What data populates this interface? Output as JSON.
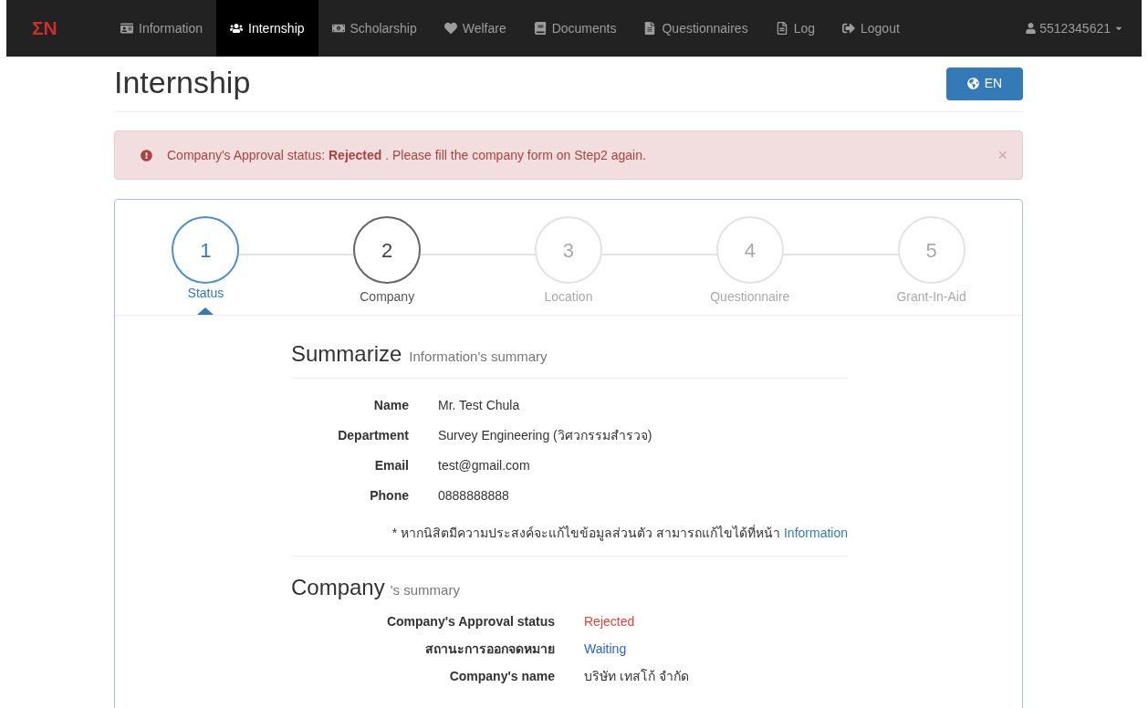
{
  "navbar": {
    "brand": "ΣN",
    "items": [
      {
        "label": "Information",
        "selected": false
      },
      {
        "label": "Internship",
        "selected": true
      },
      {
        "label": "Scholarship",
        "selected": false
      },
      {
        "label": "Welfare",
        "selected": false
      },
      {
        "label": "Documents",
        "selected": false
      },
      {
        "label": "Questionnaires",
        "selected": false
      },
      {
        "label": "Log",
        "selected": false
      },
      {
        "label": "Logout",
        "selected": false
      }
    ],
    "user": "5512345621"
  },
  "page": {
    "title": "Internship",
    "language_button": "EN"
  },
  "alert": {
    "message": "Company's Approval status: **Rejected** . Please fill the company form on Step2 again.",
    "close": "×"
  },
  "steps": [
    {
      "number": "1",
      "label": "Status",
      "kind": "active",
      "selected": true
    },
    {
      "number": "2",
      "label": "Company",
      "kind": "visited",
      "selected": false
    },
    {
      "number": "3",
      "label": "Location",
      "kind": "disabled",
      "selected": false
    },
    {
      "number": "4",
      "label": "Questionnaire",
      "kind": "disabled",
      "selected": false
    },
    {
      "number": "5",
      "label": "Grant-In-Aid",
      "kind": "disabled",
      "selected": false
    }
  ],
  "summary": {
    "heading": "Summarize",
    "subheading": "Information's summary",
    "fields": [
      {
        "label": "Name",
        "value": "Mr. Test  Chula"
      },
      {
        "label": "Department",
        "value": "Survey Engineering (วิศวกรรมสำรวจ)"
      },
      {
        "label": "Email",
        "value": "test@gmail.com"
      },
      {
        "label": "Phone",
        "value": "0888888888"
      }
    ],
    "note": {
      "text": "* หากนิสิตมีความประสงค์จะแก้ไขข้อมูลส่วนตัว สามารถแก้ไขได้ที่หน้า",
      "link": "Information"
    }
  },
  "company": {
    "heading": "Company",
    "subheading": "'s summary",
    "fields": [
      {
        "label": "Company's Approval status",
        "value": "Rejected",
        "color": "#e8413a"
      },
      {
        "label": "สถานะการออกจดหมาย",
        "value": "Waiting",
        "color": "#2b5fd9"
      },
      {
        "label": "Company's name",
        "value": "บริษัท เทสโก้ จำกัด",
        "color": "#333333"
      }
    ]
  }
}
